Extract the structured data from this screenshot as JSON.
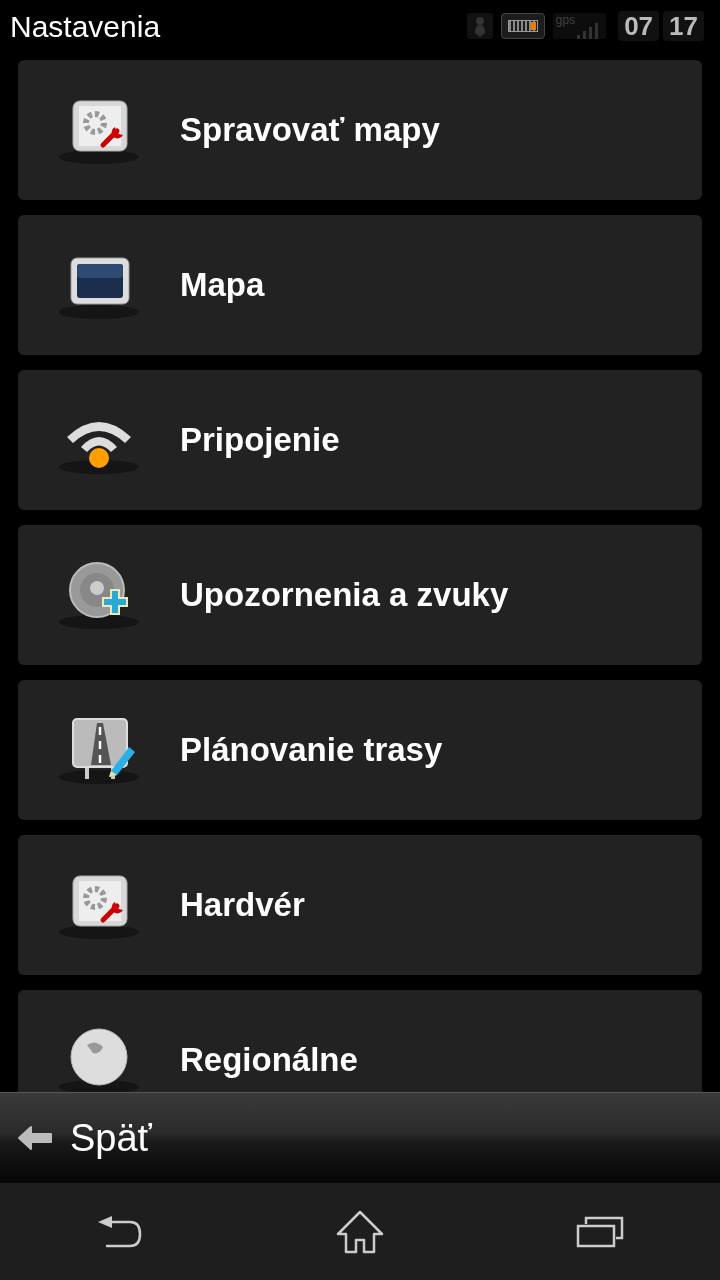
{
  "status_bar": {
    "title": "Nastavenia",
    "gps": "gps",
    "time_hours": "07",
    "time_minutes": "17"
  },
  "menu_items": [
    {
      "label": "Spravovať mapy",
      "kind": "settings"
    },
    {
      "label": "Mapa",
      "kind": "screen"
    },
    {
      "label": "Pripojenie",
      "kind": "wifi"
    },
    {
      "label": "Upozornenia a zvuky",
      "kind": "sound"
    },
    {
      "label": "Plánovanie trasy",
      "kind": "route"
    },
    {
      "label": "Hardvér",
      "kind": "settings"
    },
    {
      "label": "Regionálne",
      "kind": "globe"
    }
  ],
  "back_bar": {
    "label": "Späť"
  }
}
